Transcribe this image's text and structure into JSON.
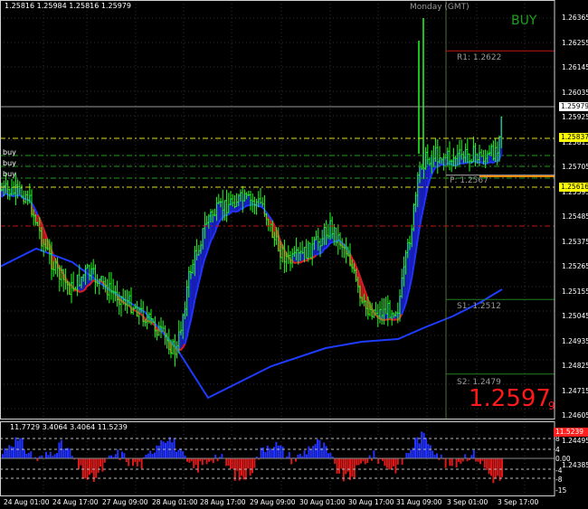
{
  "header": {
    "ohlc_text": "1.25816 1.25984 1.25816 1.25979",
    "session_label": "Monday  (GMT)",
    "signal_label": "BUY"
  },
  "big_price": {
    "value": "1.2597",
    "suffix": "9",
    "color": "#ff1a1a"
  },
  "pivots": [
    {
      "label": "R1:  1.2622",
      "level": 1.2622,
      "color": "#c81414"
    },
    {
      "label": "P:  1.2567",
      "level": 1.2567,
      "color": "#b0b0b0"
    },
    {
      "label": "S1:  1.2512",
      "level": 1.2512,
      "color": "#208020"
    },
    {
      "label": "S2:  1.2479",
      "level": 1.2479,
      "color": "#208020"
    }
  ],
  "buy_markers": [
    "buy",
    "buy",
    "buy"
  ],
  "price_axis": {
    "ticks": [
      "1.26365",
      "1.26035",
      "1.25705",
      "1.25375",
      "1.25045",
      "1.24715",
      "1.24385",
      "1.26255",
      "1.25925",
      "1.25595",
      "1.25265",
      "1.24935",
      "1.24605",
      "1.26145",
      "1.25815",
      "1.25485",
      "1.25155",
      "1.24825",
      "1.24495"
    ],
    "tick_values": [
      1.26365,
      1.26035,
      1.25705,
      1.25375,
      1.25045,
      1.24715,
      1.24385,
      1.26255,
      1.25925,
      1.25595,
      1.25265,
      1.24935,
      1.24605,
      1.26145,
      1.25815,
      1.25485,
      1.25155,
      1.24825,
      1.24495
    ],
    "current_price_tag": "1.25979",
    "tag_1": "1.25837",
    "tag_2": "1.25616",
    "tag_colors": {
      "current": "#ffffff",
      "tag_1": "#ffff00",
      "tag_2": "#ffff00"
    }
  },
  "indicator": {
    "header_text": "11.7729 3.4064 3.4064 11.5239",
    "axis_ticks": [
      "8",
      "4",
      "0.00",
      "-4",
      "-8",
      "-15"
    ],
    "top_tag": "11.5239",
    "top_tag_color": "#ff2020"
  },
  "time_axis": {
    "labels": [
      "24 Aug 01:00",
      "24 Aug 17:00",
      "27 Aug 09:00",
      "28 Aug 01:00",
      "28 Aug 17:00",
      "29 Aug 09:00",
      "30 Aug 01:00",
      "30 Aug 17:00",
      "31 Aug 09:00",
      "3 Sep 01:00",
      "3 Sep 17:00"
    ]
  },
  "colors": {
    "background": "#000000",
    "up_bar": "#22ff22",
    "ma_fast": "#2233ff",
    "ma_slow": "#1e3cff",
    "fill_up": "#1a22cc",
    "fill_down": "#cc1a1a",
    "hist_pos": "#2233ff",
    "hist_neg": "#dd1a1a",
    "dash_green": "#1ea01e",
    "dash_yellow": "#e0e020",
    "dash_red": "#c01414"
  }
}
